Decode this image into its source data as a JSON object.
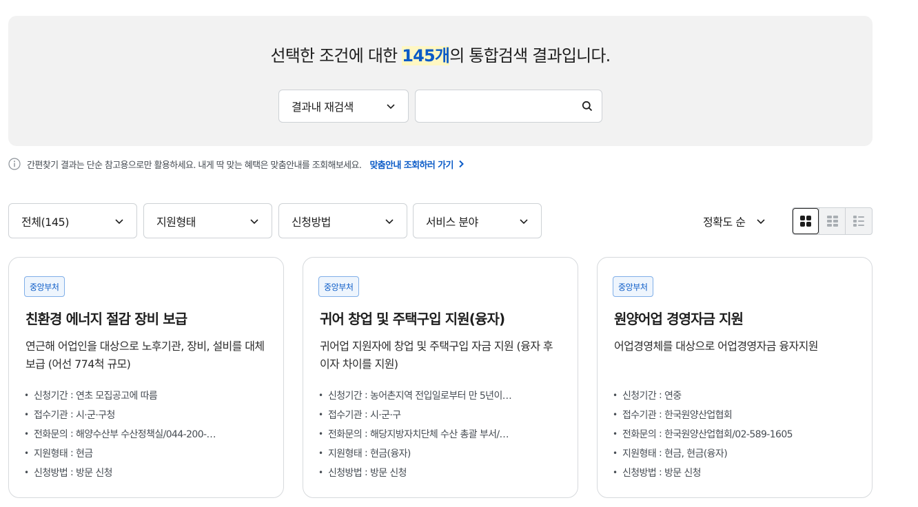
{
  "search": {
    "headline_prefix": "선택한 조건에 대한 ",
    "result_count": "145개",
    "headline_suffix": "의 통합검색 결과입니다.",
    "scope_label": "결과내 재검색",
    "query_value": "",
    "query_placeholder": ""
  },
  "notice": {
    "text": "간편찾기 결과는 단순 참고용으로만 활용하세요. 내게 딱 맞는 혜택은 맞춤안내를 조회해보세요.",
    "link_label": "맞춤안내 조회하러 가기"
  },
  "filters": [
    {
      "label": "전체(145)"
    },
    {
      "label": "지원형태"
    },
    {
      "label": "신청방법"
    },
    {
      "label": "서비스 분야"
    }
  ],
  "sort": {
    "label": "정확도 순"
  },
  "view_modes": [
    "grid-large",
    "grid-small",
    "list"
  ],
  "cards": [
    {
      "badge": "중앙부처",
      "title": "친환경 에너지 절감 장비 보급",
      "desc": "연근해 어업인을 대상으로 노후기관, 장비, 설비를 대체 보급 (어선 774척 규모)",
      "details": [
        {
          "key": "신청기간",
          "value": "연초 모집공고에 따름"
        },
        {
          "key": "접수기관",
          "value": "시·군·구청"
        },
        {
          "key": "전화문의",
          "value": "해양수산부 수산정책실/044-200-…"
        },
        {
          "key": "지원형태",
          "value": "현금"
        },
        {
          "key": "신청방법",
          "value": "방문 신청"
        }
      ]
    },
    {
      "badge": "중앙부처",
      "title": "귀어 창업 및 주택구입 지원(융자)",
      "desc": "귀어업 지원자에 창업 및 주택구입 자금 지원 (융자 후 이자 차이를 지원)",
      "details": [
        {
          "key": "신청기간",
          "value": "농어촌지역 전입일로부터 만 5년이…"
        },
        {
          "key": "접수기관",
          "value": "시·군·구"
        },
        {
          "key": "전화문의",
          "value": "해당지방자치단체 수산 총괄 부서/…"
        },
        {
          "key": "지원형태",
          "value": "현금(융자)"
        },
        {
          "key": "신청방법",
          "value": "방문 신청"
        }
      ]
    },
    {
      "badge": "중앙부처",
      "title": "원양어업 경영자금 지원",
      "desc": "어업경영체를 대상으로 어업경영자금 융자지원",
      "details": [
        {
          "key": "신청기간",
          "value": "연중"
        },
        {
          "key": "접수기관",
          "value": "한국원양산업협회"
        },
        {
          "key": "전화문의",
          "value": "한국원양산업협회/02-589-1605"
        },
        {
          "key": "지원형태",
          "value": "현금, 현금(융자)"
        },
        {
          "key": "신청방법",
          "value": "방문 신청"
        }
      ]
    }
  ],
  "colors": {
    "accent": "#0b5bc7",
    "panel_bg": "#f2f2f2",
    "highlight": "#fff7c2"
  }
}
